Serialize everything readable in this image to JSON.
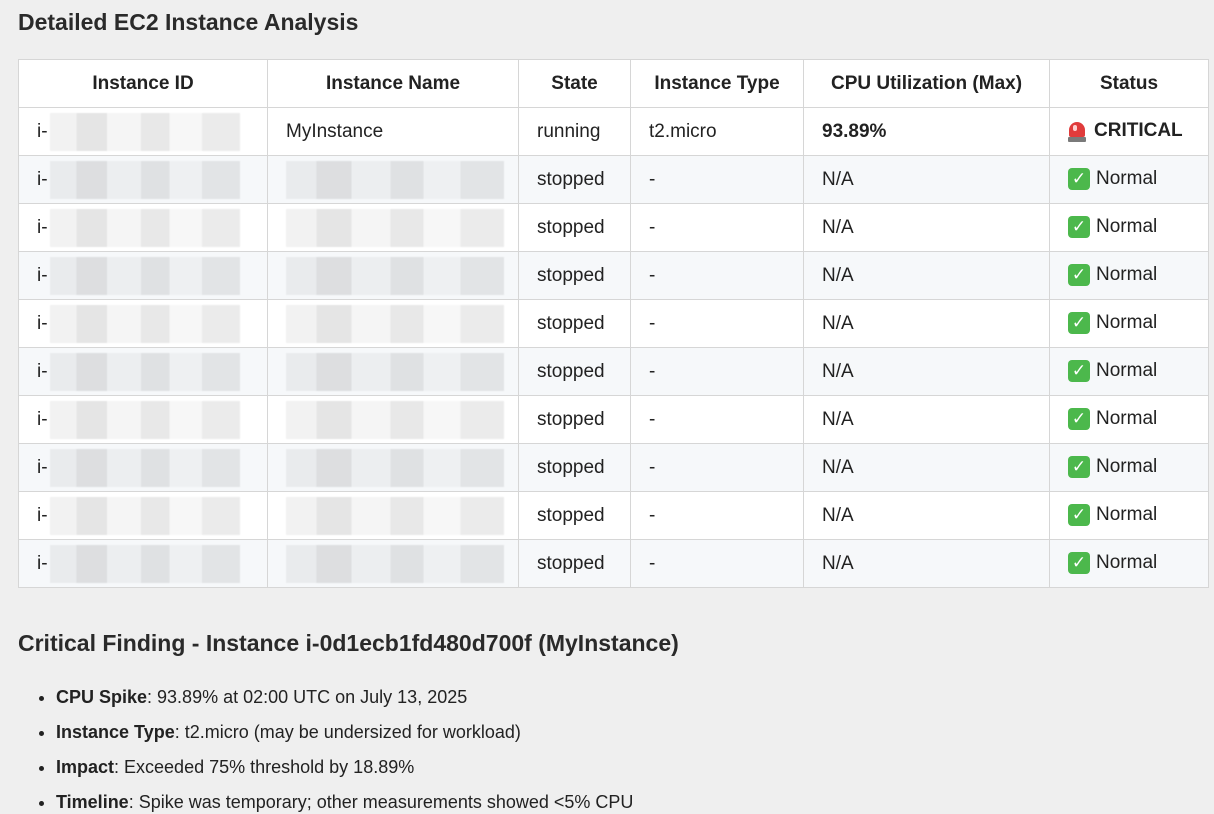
{
  "page_title": "Detailed EC2 Instance Analysis",
  "table": {
    "headers": [
      "Instance ID",
      "Instance Name",
      "State",
      "Instance Type",
      "CPU Utilization (Max)",
      "Status"
    ],
    "rows": [
      {
        "id_prefix": "i-",
        "name": "MyInstance",
        "state": "running",
        "type": "t2.micro",
        "cpu": "93.89%",
        "status": "CRITICAL",
        "status_icon": "siren-icon"
      },
      {
        "id_prefix": "i-",
        "name": "",
        "state": "stopped",
        "type": "-",
        "cpu": "N/A",
        "status": "Normal",
        "status_icon": "check-icon"
      },
      {
        "id_prefix": "i-",
        "name": "",
        "state": "stopped",
        "type": "-",
        "cpu": "N/A",
        "status": "Normal",
        "status_icon": "check-icon"
      },
      {
        "id_prefix": "i-",
        "name": "",
        "state": "stopped",
        "type": "-",
        "cpu": "N/A",
        "status": "Normal",
        "status_icon": "check-icon"
      },
      {
        "id_prefix": "i-",
        "name": "",
        "state": "stopped",
        "type": "-",
        "cpu": "N/A",
        "status": "Normal",
        "status_icon": "check-icon"
      },
      {
        "id_prefix": "i-",
        "name": "",
        "state": "stopped",
        "type": "-",
        "cpu": "N/A",
        "status": "Normal",
        "status_icon": "check-icon"
      },
      {
        "id_prefix": "i-",
        "name": "",
        "state": "stopped",
        "type": "-",
        "cpu": "N/A",
        "status": "Normal",
        "status_icon": "check-icon"
      },
      {
        "id_prefix": "i-",
        "name": "",
        "state": "stopped",
        "type": "-",
        "cpu": "N/A",
        "status": "Normal",
        "status_icon": "check-icon"
      },
      {
        "id_prefix": "i-",
        "name": "",
        "state": "stopped",
        "type": "-",
        "cpu": "N/A",
        "status": "Normal",
        "status_icon": "check-icon"
      },
      {
        "id_prefix": "i-",
        "name": "",
        "state": "stopped",
        "type": "-",
        "cpu": "N/A",
        "status": "Normal",
        "status_icon": "check-icon"
      }
    ]
  },
  "finding": {
    "title": "Critical Finding - Instance i-0d1ecb1fd480d700f (MyInstance)",
    "items": [
      {
        "label": "CPU Spike",
        "text": ": 93.89% at 02:00 UTC on July 13, 2025"
      },
      {
        "label": "Instance Type",
        "text": ": t2.micro (may be undersized for workload)"
      },
      {
        "label": "Impact",
        "text": ": Exceeded 75% threshold by 18.89%"
      },
      {
        "label": "Timeline",
        "text": ": Spike was temporary; other measurements showed <5% CPU"
      }
    ]
  },
  "colors": {
    "critical": "#e03b3b",
    "normal_check": "#4cb84c",
    "row_alt": "#f6f8fa",
    "border": "#d6d6d6"
  }
}
